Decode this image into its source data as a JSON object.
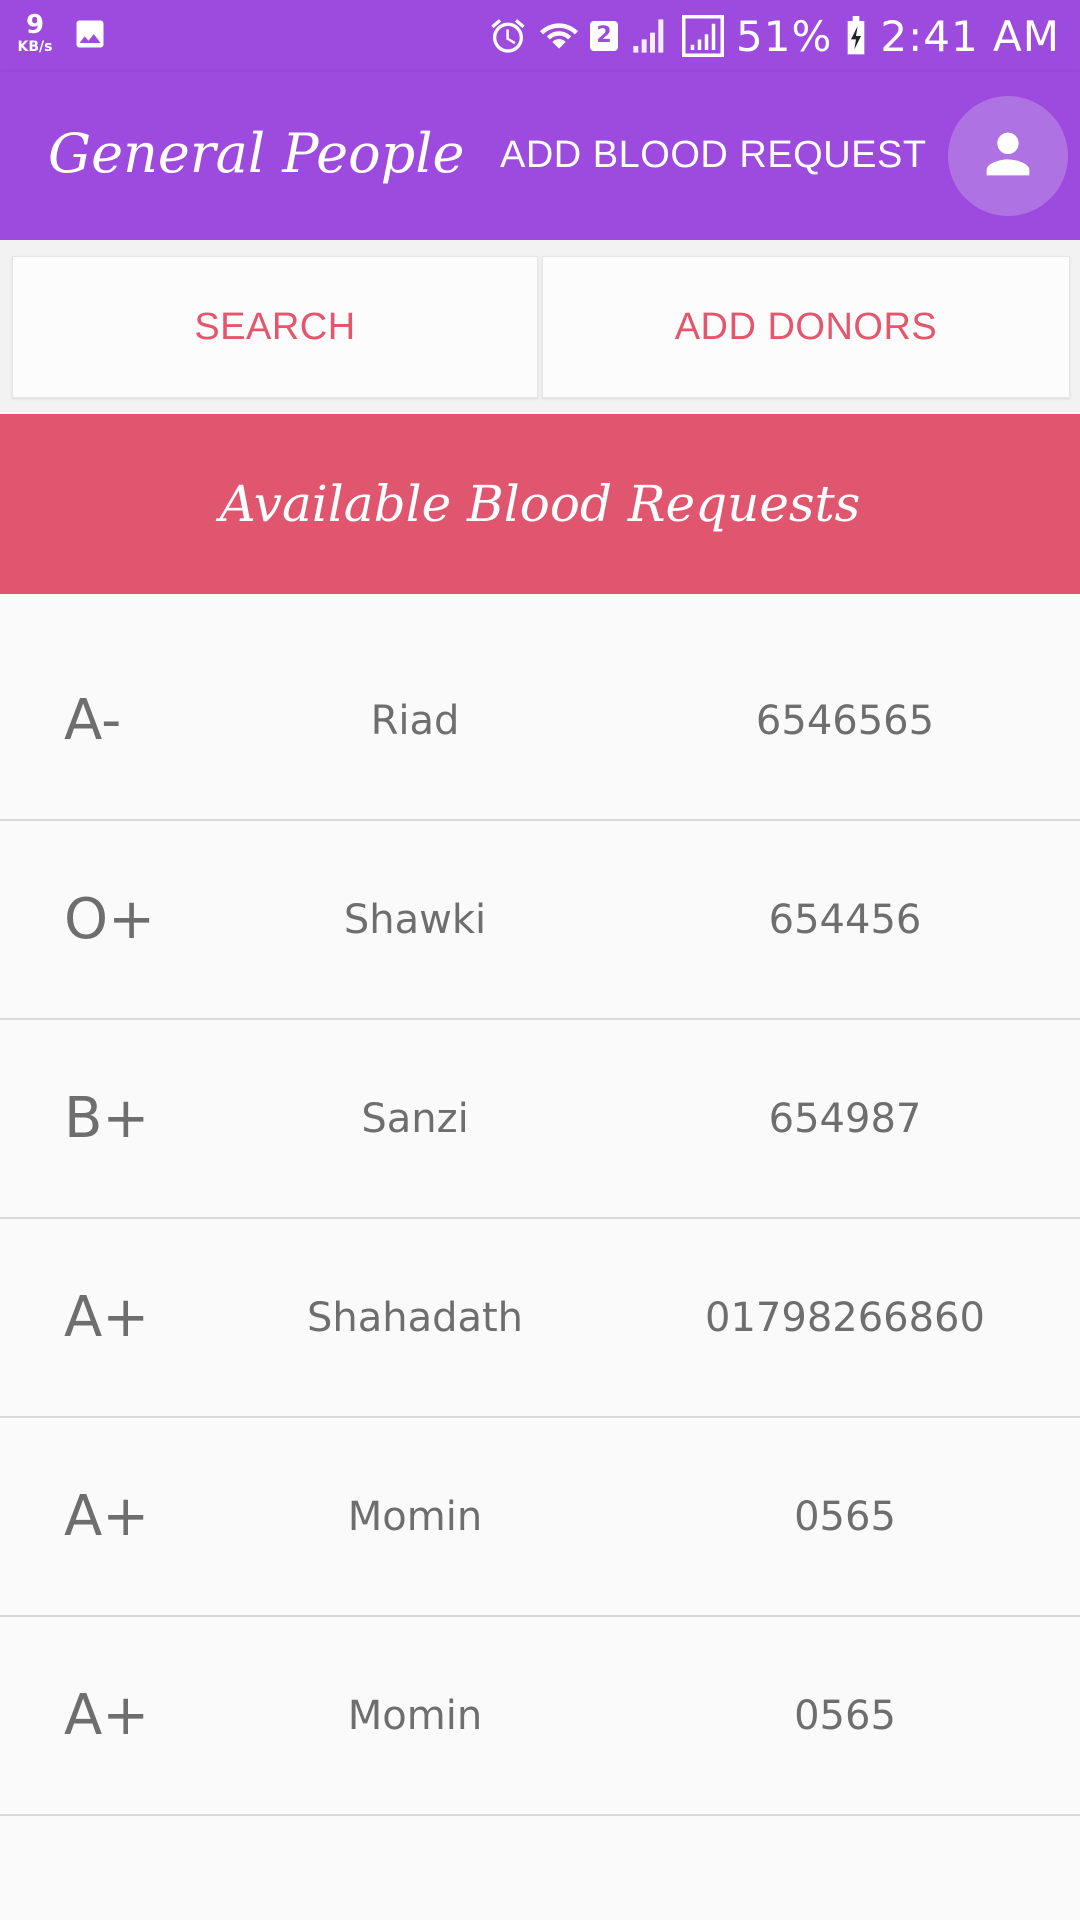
{
  "status_bar": {
    "speed_value": "9",
    "speed_unit": "KB/s",
    "sim_slot": "2",
    "battery": "51%",
    "time": "2:41 AM",
    "icons": [
      "gallery-icon",
      "alarm-icon",
      "wifi-icon",
      "signal-icon",
      "battery-icon"
    ]
  },
  "app_bar": {
    "title": "General People",
    "action_label": "ADD BLOOD REQUEST",
    "avatar_icon": "person-icon",
    "color": "#9c4bde"
  },
  "buttons": {
    "search_label": "SEARCH",
    "add_donors_label": "ADD DONORS",
    "text_color": "#e4566c"
  },
  "banner": {
    "title": "Available Blood Requests",
    "color": "#e0566f"
  },
  "requests": [
    {
      "blood_group": "A-",
      "name": "Riad",
      "phone": "6546565"
    },
    {
      "blood_group": "O+",
      "name": "Shawki",
      "phone": "654456"
    },
    {
      "blood_group": "B+",
      "name": "Sanzi",
      "phone": "654987"
    },
    {
      "blood_group": "A+",
      "name": "Shahadath",
      "phone": "01798266860"
    },
    {
      "blood_group": "A+",
      "name": "Momin",
      "phone": "0565"
    },
    {
      "blood_group": "A+",
      "name": "Momin",
      "phone": "0565"
    }
  ]
}
